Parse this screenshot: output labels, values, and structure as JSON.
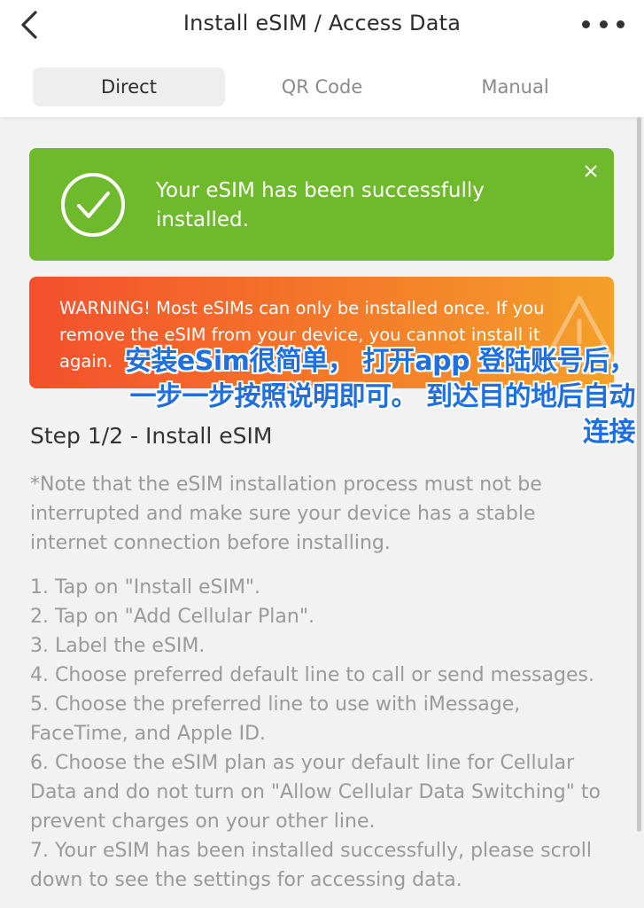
{
  "header": {
    "title": "Install eSIM / Access Data"
  },
  "tabs": [
    {
      "label": "Direct",
      "active": true
    },
    {
      "label": "QR Code",
      "active": false
    },
    {
      "label": "Manual",
      "active": false
    }
  ],
  "success_alert": {
    "message": "Your eSIM has been successfully installed.",
    "icon": "check-circle-icon",
    "color": "#6fba2c"
  },
  "warning_alert": {
    "message": "WARNING! Most eSIMs can only be installed once. If you remove the eSIM from your device, you cannot install it again.",
    "icon": "warning-triangle-icon",
    "colors": [
      "#f4502c",
      "#f4a02a"
    ]
  },
  "overlay_text": {
    "line1": "安装eSim很简单， 打开app 登陆账号后，",
    "line2": "一步一步按照说明即可。 到达目的地后自动",
    "line3": "连接",
    "color": "#1f6fe0"
  },
  "step": {
    "title": "Step 1/2 - Install eSIM",
    "note": "*Note that the eSIM installation process must not be interrupted and make sure your device has a stable internet connection before installing.",
    "items": [
      "1. Tap on \"Install eSIM\".",
      "2. Tap on \"Add Cellular Plan\".",
      "3. Label the eSIM.",
      "4. Choose preferred default line to call or send messages.",
      "5. Choose the preferred line to use with iMessage, FaceTime, and Apple ID.",
      "6. Choose the eSIM plan as your default line for Cellular Data and do not turn on \"Allow Cellular Data Switching\" to prevent charges on your other line.",
      "7. Your eSIM has been installed successfully, please scroll down to see the settings for accessing data."
    ]
  }
}
